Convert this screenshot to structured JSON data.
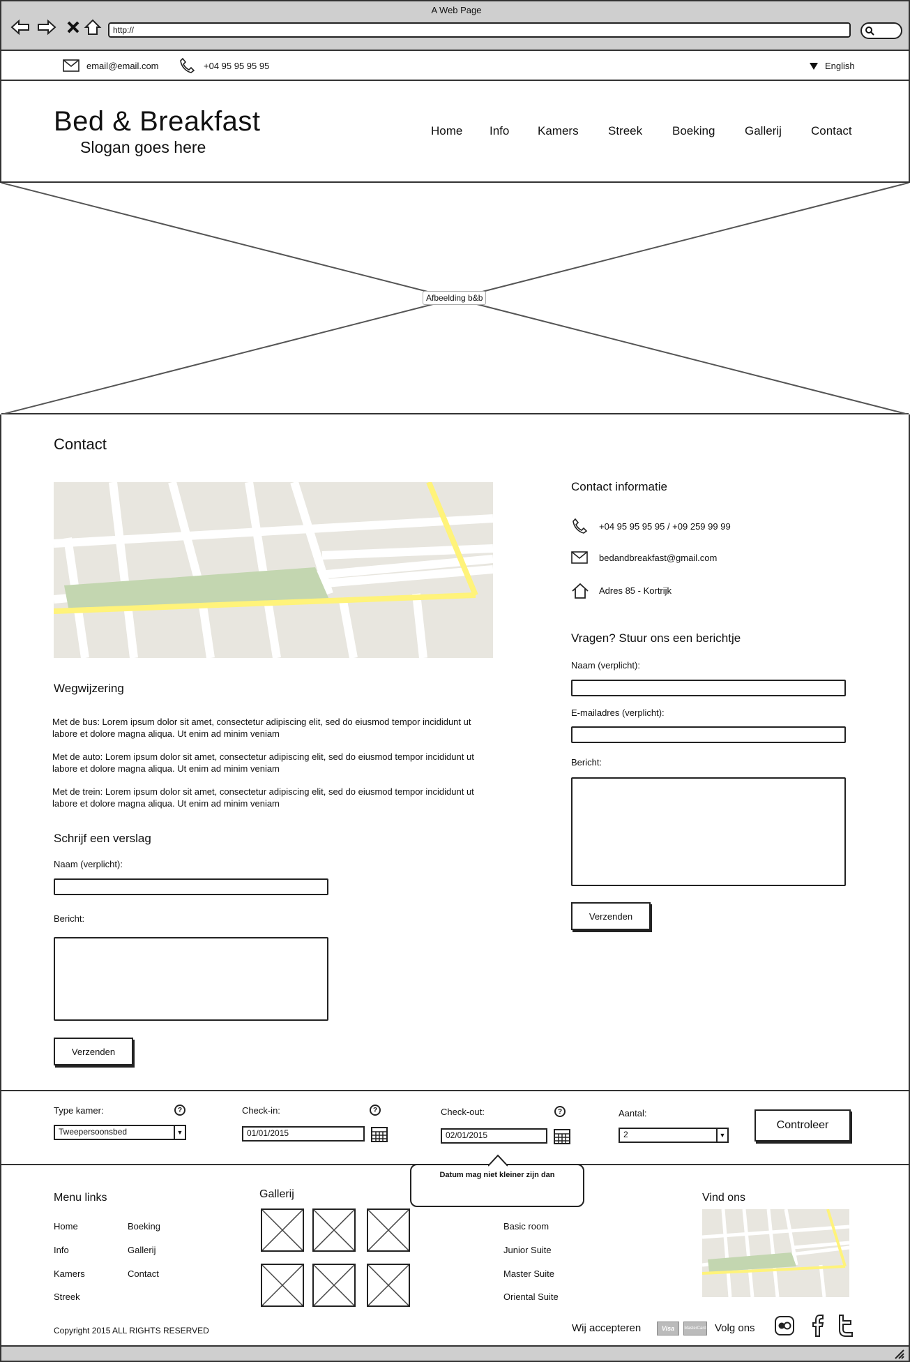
{
  "browser": {
    "title": "A Web Page",
    "url": "http://"
  },
  "topbar": {
    "email": "email@email.com",
    "phone": "+04 95 95 95 95",
    "language": "English"
  },
  "header": {
    "brand": "Bed & Breakfast",
    "slogan": "Slogan goes here",
    "nav": [
      "Home",
      "Info",
      "Kamers",
      "Streek",
      "Boeking",
      "Gallerij",
      "Contact"
    ]
  },
  "hero": {
    "label": "Afbeelding b&b"
  },
  "main": {
    "title": "Contact",
    "directions_title": "Wegwijzering",
    "directions": [
      "Met de bus: Lorem ipsum dolor sit amet, consectetur adipiscing elit, sed do eiusmod tempor incididunt ut labore et dolore magna aliqua. Ut enim ad minim veniam",
      "Met de auto: Lorem ipsum dolor sit amet, consectetur adipiscing elit, sed do eiusmod tempor incididunt ut labore et dolore magna aliqua. Ut enim ad minim veniam",
      "Met de trein: Lorem ipsum dolor sit amet, consectetur adipiscing elit, sed do eiusmod tempor incididunt ut labore et dolore magna aliqua. Ut enim ad minim veniam"
    ],
    "review": {
      "title": "Schrijf een verslag",
      "name_label": "Naam (verplicht):",
      "message_label": "Bericht:",
      "submit": "Verzenden"
    },
    "contact_info": {
      "title": "Contact informatie",
      "phone": "+04 95 95 95 95 / +09 259 99 99",
      "email": "bedandbreakfast@gmail.com",
      "address": "Adres 85 - Kortrijk"
    },
    "question_form": {
      "title": "Vragen? Stuur ons een berichtje",
      "name_label": "Naam (verplicht):",
      "email_label": "E-mailadres (verplicht):",
      "message_label": "Bericht:",
      "submit": "Verzenden"
    }
  },
  "booking": {
    "room_label": "Type kamer:",
    "room_value": "Tweepersoonsbed",
    "checkin_label": "Check-in:",
    "checkin_value": "01/01/2015",
    "checkout_label": "Check-out:",
    "checkout_value": "02/01/2015",
    "count_label": "Aantal:",
    "count_value": "2",
    "submit": "Controleer",
    "tooltip": "Datum mag niet kleiner zijn dan"
  },
  "footer": {
    "menu_title": "Menu links",
    "menu_col1": [
      "Home",
      "Info",
      "Kamers",
      "Streek"
    ],
    "menu_col2": [
      "Boeking",
      "Gallerij",
      "Contact"
    ],
    "gallery_title": "Gallerij",
    "rooms": [
      "Basic room",
      "Junior Suite",
      "Master Suite",
      "Oriental Suite"
    ],
    "find_title": "Vind ons",
    "copyright": "Copyright 2015 ALL RIGHTS RESERVED",
    "accept_label": "Wij accepteren",
    "follow_label": "Volg ons",
    "card_visa": "Visa",
    "card_mastercard": "MasterCard"
  },
  "colors": {
    "map_bg": "#e8e6df",
    "map_road": "#ffffff",
    "map_highway": "#fff37a",
    "map_park": "#c3d6b0"
  }
}
